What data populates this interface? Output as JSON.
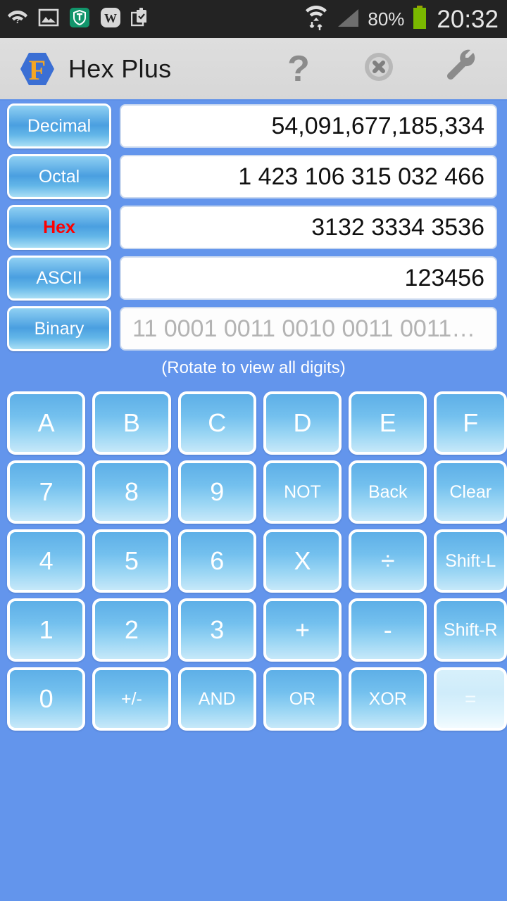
{
  "status_bar": {
    "time": "20:32",
    "battery_percent": "80%",
    "left_icons": [
      "wifi-question-icon",
      "gallery-icon",
      "shield-t-icon",
      "w-app-icon",
      "clipboard-check-icon"
    ],
    "right_icons": [
      "wifi-data-icon",
      "cellular-signal-icon",
      "battery-icon"
    ],
    "background_color": "#232323",
    "battery_color": "#7ab800"
  },
  "header": {
    "title": "Hex Plus",
    "logo_icon": "hexagon-f-logo",
    "logo_colors": {
      "hexagon": "#3b6fd4",
      "letter": "#f5a623"
    },
    "actions": [
      {
        "name": "help-button",
        "icon": "question-mark-icon",
        "label": "?"
      },
      {
        "name": "close-button",
        "icon": "close-circle-icon",
        "label": ""
      },
      {
        "name": "settings-button",
        "icon": "wrench-icon",
        "label": ""
      }
    ],
    "background_color": "#dedede"
  },
  "conversions": {
    "rows": [
      {
        "label": "Decimal",
        "value": "54,091,677,185,334",
        "active": false,
        "dim": false
      },
      {
        "label": "Octal",
        "value": "1 423 106 315 032 466",
        "active": false,
        "dim": false
      },
      {
        "label": "Hex",
        "value": "3132 3334 3536",
        "active": true,
        "dim": false
      },
      {
        "label": "ASCII",
        "value": "123456",
        "active": false,
        "dim": false
      },
      {
        "label": "Binary",
        "value": "11 0001 0011 0010 0011 0011…",
        "active": false,
        "dim": true
      }
    ],
    "hint": "(Rotate to view all digits)",
    "active_label_color": "#ff0000"
  },
  "keypad": {
    "rows": [
      [
        {
          "label": "A",
          "size": "big"
        },
        {
          "label": "B",
          "size": "big"
        },
        {
          "label": "C",
          "size": "big"
        },
        {
          "label": "D",
          "size": "big"
        },
        {
          "label": "E",
          "size": "big"
        },
        {
          "label": "F",
          "size": "big"
        }
      ],
      [
        {
          "label": "7",
          "size": "big"
        },
        {
          "label": "8",
          "size": "big"
        },
        {
          "label": "9",
          "size": "big"
        },
        {
          "label": "NOT",
          "size": "sm"
        },
        {
          "label": "Back",
          "size": "sm"
        },
        {
          "label": "Clear",
          "size": "sm"
        }
      ],
      [
        {
          "label": "4",
          "size": "big"
        },
        {
          "label": "5",
          "size": "big"
        },
        {
          "label": "6",
          "size": "big"
        },
        {
          "label": "X",
          "size": "big"
        },
        {
          "label": "÷",
          "size": "big"
        },
        {
          "label": "Shift-L",
          "size": "sm"
        }
      ],
      [
        {
          "label": "1",
          "size": "big"
        },
        {
          "label": "2",
          "size": "big"
        },
        {
          "label": "3",
          "size": "big"
        },
        {
          "label": "+",
          "size": "big"
        },
        {
          "label": "-",
          "size": "big"
        },
        {
          "label": "Shift-R",
          "size": "sm"
        }
      ],
      [
        {
          "label": "0",
          "size": "big"
        },
        {
          "label": "+/-",
          "size": "sm"
        },
        {
          "label": "AND",
          "size": "sm"
        },
        {
          "label": "OR",
          "size": "sm"
        },
        {
          "label": "XOR",
          "size": "sm"
        },
        {
          "label": "=",
          "size": "sm",
          "highlight": true
        }
      ]
    ]
  },
  "theme": {
    "page_background": "#6395ec",
    "key_border": "#ffffff",
    "key_gradient_top": "#5eafe7",
    "key_gradient_bottom": "#c6e8f9"
  }
}
